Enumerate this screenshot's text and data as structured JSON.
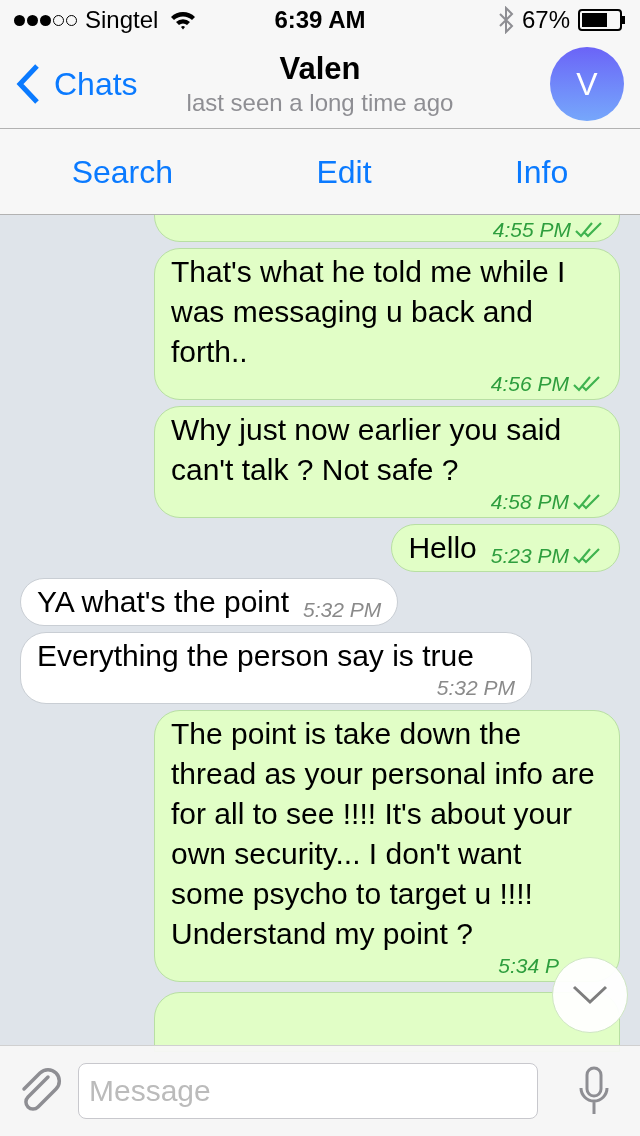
{
  "status_bar": {
    "carrier": "Singtel",
    "time": "6:39 AM",
    "battery": "67%"
  },
  "nav": {
    "back": "Chats",
    "title": "Valen",
    "subtitle": "last seen a long time ago",
    "avatar_letter": "V"
  },
  "toolbar": [
    "Search",
    "Edit",
    "Info"
  ],
  "messages": [
    {
      "kind": "outgoing",
      "time": "4:55 PM",
      "ticks": true
    },
    {
      "kind": "outgoing",
      "text": "That's what he told me while I was messaging u back and forth..",
      "time": "4:56 PM",
      "ticks": true
    },
    {
      "kind": "outgoing",
      "text": "Why just now earlier you said can't talk ? Not safe ?",
      "time": "4:58 PM",
      "ticks": true
    },
    {
      "kind": "outgoing",
      "text": "Hello",
      "time": "5:23 PM",
      "ticks": true
    },
    {
      "kind": "incoming",
      "text": "YA what's the point",
      "time": "5:32 PM"
    },
    {
      "kind": "incoming",
      "text": "Everything the person say is true",
      "time": "5:32 PM"
    },
    {
      "kind": "outgoing",
      "text": "The point is take down the thread as your personal info are for all to see !!!! It's about your own security... I don't want some psycho to target u !!!! Understand my point ?",
      "time": "5:34 P",
      "ticks": false
    },
    {
      "kind": "outgoing"
    }
  ],
  "composer": {
    "placeholder": "Message"
  }
}
